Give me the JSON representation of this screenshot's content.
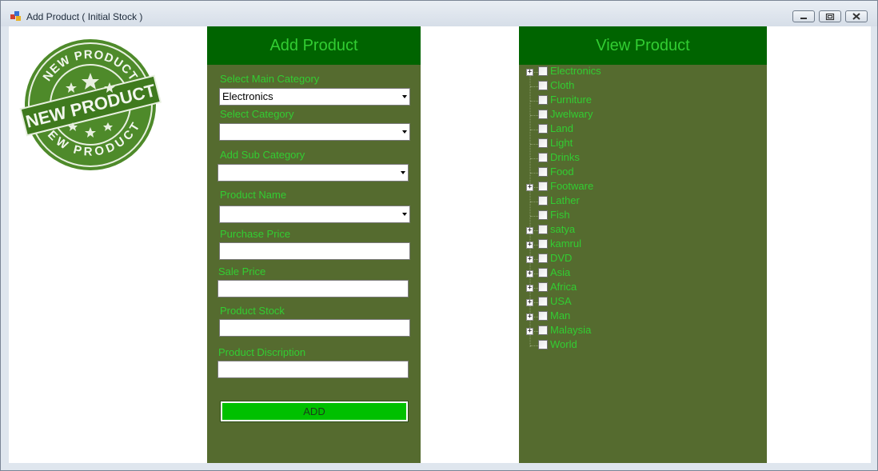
{
  "window": {
    "title": "Add Product ( Initial Stock )",
    "controls": {
      "minimize": "−",
      "restore": "□",
      "close": "✕"
    }
  },
  "logo": {
    "icon": "new-product-stamp",
    "text_top": "NEW PRODUCT",
    "text_center": "NEW PRODUCT",
    "text_bottom": "NEW PRODUCT"
  },
  "add_panel": {
    "header": "Add Product",
    "main_category_label": "Select Main Category",
    "main_category_value": "Electronics",
    "category_label": "Select Category",
    "category_value": "",
    "sub_category_label": "Add Sub Category",
    "sub_category_value": "",
    "product_name_label": "Product Name",
    "product_name_value": "",
    "purchase_price_label": "Purchase Price",
    "purchase_price_value": "",
    "sale_price_label": "Sale Price",
    "sale_price_value": "",
    "product_stock_label": "Product Stock",
    "product_stock_value": "",
    "description_label": "Product Discription",
    "description_value": "",
    "add_button": "ADD"
  },
  "view_panel": {
    "header": "View Product",
    "tree": [
      {
        "label": "Electronics",
        "expandable": true
      },
      {
        "label": "Cloth",
        "expandable": false
      },
      {
        "label": "Furniture",
        "expandable": false
      },
      {
        "label": "Jwelwary",
        "expandable": false
      },
      {
        "label": "Land",
        "expandable": false
      },
      {
        "label": "Light",
        "expandable": false
      },
      {
        "label": "Drinks",
        "expandable": false
      },
      {
        "label": "Food",
        "expandable": false
      },
      {
        "label": "Footware",
        "expandable": true
      },
      {
        "label": "Lather",
        "expandable": false
      },
      {
        "label": "Fish",
        "expandable": false
      },
      {
        "label": "satya",
        "expandable": true
      },
      {
        "label": "kamrul",
        "expandable": true
      },
      {
        "label": "DVD",
        "expandable": true
      },
      {
        "label": "Asia",
        "expandable": true
      },
      {
        "label": "Africa",
        "expandable": true
      },
      {
        "label": "USA",
        "expandable": true
      },
      {
        "label": "Man",
        "expandable": true
      },
      {
        "label": "Malaysia",
        "expandable": true
      },
      {
        "label": "World",
        "expandable": false
      }
    ]
  },
  "colors": {
    "panel_bg": "#556b2f",
    "header_bg": "#006400",
    "text_green": "#32cd32",
    "button_green": "#00c000"
  }
}
